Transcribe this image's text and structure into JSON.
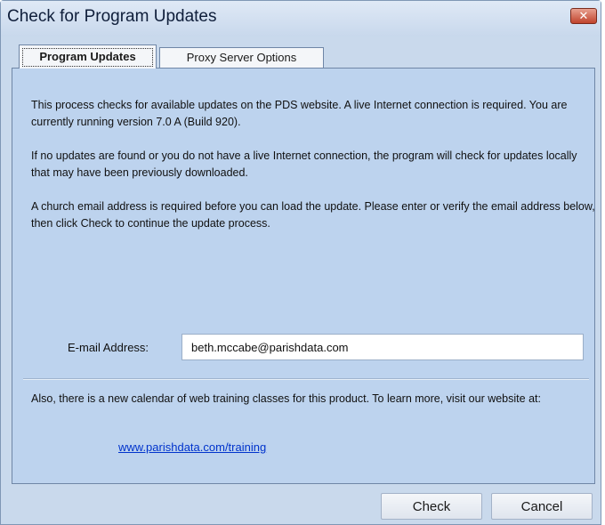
{
  "window": {
    "title": "Check for Program Updates",
    "close_label": "✕"
  },
  "tabs": [
    {
      "label": "Program Updates",
      "active": true
    },
    {
      "label": "Proxy Server Options",
      "active": false
    }
  ],
  "content": {
    "paragraph1": "This process checks for available updates on the PDS website. A live Internet connection is required. You are currently running version 7.0 A  (Build 920).",
    "paragraph2": "If no updates are found or you do not have a live Internet connection, the program will check for updates locally that may have been previously downloaded.",
    "paragraph3": "A church email address is required before you can load the update. Please enter or verify the email address below, then click Check to continue the update process.",
    "email_label": "E-mail Address:",
    "email_value": "beth.mccabe@parishdata.com",
    "paragraph4": "Also, there is a new calendar of web training classes for this product. To learn more, visit our website at:",
    "training_link": "www.parishdata.com/training"
  },
  "buttons": {
    "check": "Check",
    "cancel": "Cancel"
  },
  "colors": {
    "panel_background": "#bdd3ee",
    "link": "#0033cc",
    "close_button": "#c0432c"
  }
}
